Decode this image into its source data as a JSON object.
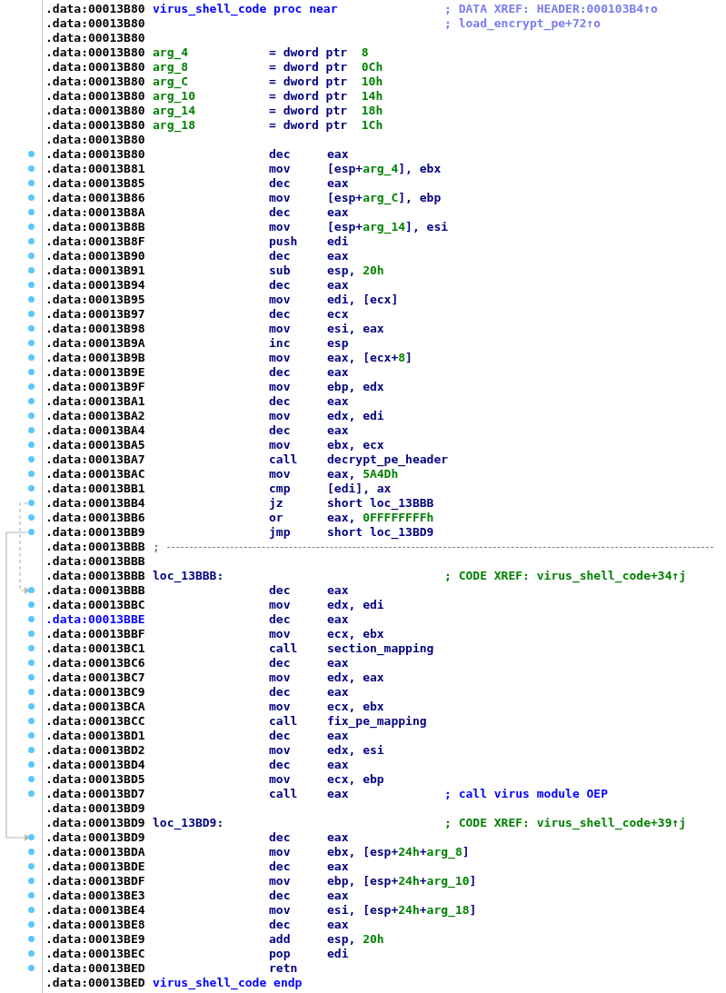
{
  "listing": {
    "rows": [
      {
        "kind": "proc",
        "address": ".data:00013B80",
        "name": "virus_shell_code",
        "directive": "proc near",
        "comment": {
          "kind": "data_xref",
          "text": "; DATA XREF: HEADER:000103B4↑o"
        },
        "selected": false
      },
      {
        "kind": "blank",
        "address": ".data:00013B80",
        "comment": {
          "kind": "data_xref",
          "text": "; load_encrypt_pe+72↑o"
        },
        "selected": false
      },
      {
        "kind": "blank",
        "address": ".data:00013B80",
        "selected": false
      },
      {
        "kind": "arg",
        "address": ".data:00013B80",
        "name": "arg_4",
        "definition": "= dword ptr  8",
        "selected": false
      },
      {
        "kind": "arg",
        "address": ".data:00013B80",
        "name": "arg_8",
        "definition": "= dword ptr  0Ch",
        "selected": false
      },
      {
        "kind": "arg",
        "address": ".data:00013B80",
        "name": "arg_C",
        "definition": "= dword ptr  10h",
        "selected": false
      },
      {
        "kind": "arg",
        "address": ".data:00013B80",
        "name": "arg_10",
        "definition": "= dword ptr  14h",
        "selected": false
      },
      {
        "kind": "arg",
        "address": ".data:00013B80",
        "name": "arg_14",
        "definition": "= dword ptr  18h",
        "selected": false
      },
      {
        "kind": "arg",
        "address": ".data:00013B80",
        "name": "arg_18",
        "definition": "= dword ptr  1Ch",
        "selected": false
      },
      {
        "kind": "blank",
        "address": ".data:00013B80",
        "selected": false
      },
      {
        "kind": "insn",
        "address": ".data:00013B80",
        "mnemonic": "dec",
        "operands": "eax",
        "selected": false
      },
      {
        "kind": "insn",
        "address": ".data:00013B81",
        "mnemonic": "mov",
        "operands": "[esp+arg_4], ebx",
        "selected": false
      },
      {
        "kind": "insn",
        "address": ".data:00013B85",
        "mnemonic": "dec",
        "operands": "eax",
        "selected": false
      },
      {
        "kind": "insn",
        "address": ".data:00013B86",
        "mnemonic": "mov",
        "operands": "[esp+arg_C], ebp",
        "selected": false
      },
      {
        "kind": "insn",
        "address": ".data:00013B8A",
        "mnemonic": "dec",
        "operands": "eax",
        "selected": false
      },
      {
        "kind": "insn",
        "address": ".data:00013B8B",
        "mnemonic": "mov",
        "operands": "[esp+arg_14], esi",
        "selected": false
      },
      {
        "kind": "insn",
        "address": ".data:00013B8F",
        "mnemonic": "push",
        "operands": "edi",
        "selected": false
      },
      {
        "kind": "insn",
        "address": ".data:00013B90",
        "mnemonic": "dec",
        "operands": "eax",
        "selected": false
      },
      {
        "kind": "insn",
        "address": ".data:00013B91",
        "mnemonic": "sub",
        "operands": "esp, 20h",
        "selected": false
      },
      {
        "kind": "insn",
        "address": ".data:00013B94",
        "mnemonic": "dec",
        "operands": "eax",
        "selected": false
      },
      {
        "kind": "insn",
        "address": ".data:00013B95",
        "mnemonic": "mov",
        "operands": "edi, [ecx]",
        "selected": false
      },
      {
        "kind": "insn",
        "address": ".data:00013B97",
        "mnemonic": "dec",
        "operands": "ecx",
        "selected": false
      },
      {
        "kind": "insn",
        "address": ".data:00013B98",
        "mnemonic": "mov",
        "operands": "esi, eax",
        "selected": false
      },
      {
        "kind": "insn",
        "address": ".data:00013B9A",
        "mnemonic": "inc",
        "operands": "esp",
        "selected": false
      },
      {
        "kind": "insn",
        "address": ".data:00013B9B",
        "mnemonic": "mov",
        "operands": "eax, [ecx+8]",
        "selected": false
      },
      {
        "kind": "insn",
        "address": ".data:00013B9E",
        "mnemonic": "dec",
        "operands": "eax",
        "selected": false
      },
      {
        "kind": "insn",
        "address": ".data:00013B9F",
        "mnemonic": "mov",
        "operands": "ebp, edx",
        "selected": false
      },
      {
        "kind": "insn",
        "address": ".data:00013BA1",
        "mnemonic": "dec",
        "operands": "eax",
        "selected": false
      },
      {
        "kind": "insn",
        "address": ".data:00013BA2",
        "mnemonic": "mov",
        "operands": "edx, edi",
        "selected": false
      },
      {
        "kind": "insn",
        "address": ".data:00013BA4",
        "mnemonic": "dec",
        "operands": "eax",
        "selected": false
      },
      {
        "kind": "insn",
        "address": ".data:00013BA5",
        "mnemonic": "mov",
        "operands": "ebx, ecx",
        "selected": false
      },
      {
        "kind": "insn",
        "address": ".data:00013BA7",
        "mnemonic": "call",
        "operands": "decrypt_pe_header",
        "selected": false
      },
      {
        "kind": "insn",
        "address": ".data:00013BAC",
        "mnemonic": "mov",
        "operands": "eax, 5A4Dh",
        "selected": false
      },
      {
        "kind": "insn",
        "address": ".data:00013BB1",
        "mnemonic": "cmp",
        "operands": "[edi], ax",
        "selected": false
      },
      {
        "kind": "insn",
        "address": ".data:00013BB4",
        "mnemonic": "jz",
        "operands": "short loc_13BBB",
        "jump": true,
        "dashed": true,
        "selected": false
      },
      {
        "kind": "insn",
        "address": ".data:00013BB6",
        "mnemonic": "or",
        "operands": "eax, 0FFFFFFFFh",
        "selected": false
      },
      {
        "kind": "insn",
        "address": ".data:00013BB9",
        "mnemonic": "jmp",
        "operands": "short loc_13BD9",
        "jump": true,
        "dashed": false,
        "selected": false
      },
      {
        "kind": "separator",
        "address": ".data:00013BBB",
        "text": ";",
        "selected": false
      },
      {
        "kind": "blank",
        "address": ".data:00013BBB",
        "selected": false
      },
      {
        "kind": "label",
        "address": ".data:00013BBB",
        "name": "loc_13BBB:",
        "comment": {
          "kind": "code_xref",
          "text": "; CODE XREF: virus_shell_code+34↑j"
        },
        "selected": false
      },
      {
        "kind": "insn",
        "address": ".data:00013BBB",
        "mnemonic": "dec",
        "operands": "eax",
        "jump_target": true,
        "selected": false
      },
      {
        "kind": "insn",
        "address": ".data:00013BBC",
        "mnemonic": "mov",
        "operands": "edx, edi",
        "selected": false
      },
      {
        "kind": "insn",
        "address": ".data:00013BBE",
        "mnemonic": "dec",
        "operands": "eax",
        "selected": true
      },
      {
        "kind": "insn",
        "address": ".data:00013BBF",
        "mnemonic": "mov",
        "operands": "ecx, ebx",
        "selected": false
      },
      {
        "kind": "insn",
        "address": ".data:00013BC1",
        "mnemonic": "call",
        "operands": "section_mapping",
        "selected": false
      },
      {
        "kind": "insn",
        "address": ".data:00013BC6",
        "mnemonic": "dec",
        "operands": "eax",
        "selected": false
      },
      {
        "kind": "insn",
        "address": ".data:00013BC7",
        "mnemonic": "mov",
        "operands": "edx, eax",
        "selected": false
      },
      {
        "kind": "insn",
        "address": ".data:00013BC9",
        "mnemonic": "dec",
        "operands": "eax",
        "selected": false
      },
      {
        "kind": "insn",
        "address": ".data:00013BCA",
        "mnemonic": "mov",
        "operands": "ecx, ebx",
        "selected": false
      },
      {
        "kind": "insn",
        "address": ".data:00013BCC",
        "mnemonic": "call",
        "operands": "fix_pe_mapping",
        "selected": false
      },
      {
        "kind": "insn",
        "address": ".data:00013BD1",
        "mnemonic": "dec",
        "operands": "eax",
        "selected": false
      },
      {
        "kind": "insn",
        "address": ".data:00013BD2",
        "mnemonic": "mov",
        "operands": "edx, esi",
        "selected": false
      },
      {
        "kind": "insn",
        "address": ".data:00013BD4",
        "mnemonic": "dec",
        "operands": "eax",
        "selected": false
      },
      {
        "kind": "insn",
        "address": ".data:00013BD5",
        "mnemonic": "mov",
        "operands": "ecx, ebp",
        "selected": false
      },
      {
        "kind": "insn",
        "address": ".data:00013BD7",
        "mnemonic": "call",
        "operands": "eax",
        "comment": {
          "kind": "note",
          "text": "; call virus module OEP"
        },
        "selected": false
      },
      {
        "kind": "blank",
        "address": ".data:00013BD9",
        "selected": false
      },
      {
        "kind": "label",
        "address": ".data:00013BD9",
        "name": "loc_13BD9:",
        "comment": {
          "kind": "code_xref",
          "text": "; CODE XREF: virus_shell_code+39↑j"
        },
        "selected": false
      },
      {
        "kind": "insn",
        "address": ".data:00013BD9",
        "mnemonic": "dec",
        "operands": "eax",
        "jump_target": true,
        "selected": false
      },
      {
        "kind": "insn",
        "address": ".data:00013BDA",
        "mnemonic": "mov",
        "operands": "ebx, [esp+24h+arg_8]",
        "selected": false
      },
      {
        "kind": "insn",
        "address": ".data:00013BDE",
        "mnemonic": "dec",
        "operands": "eax",
        "selected": false
      },
      {
        "kind": "insn",
        "address": ".data:00013BDF",
        "mnemonic": "mov",
        "operands": "ebp, [esp+24h+arg_10]",
        "selected": false
      },
      {
        "kind": "insn",
        "address": ".data:00013BE3",
        "mnemonic": "dec",
        "operands": "eax",
        "selected": false
      },
      {
        "kind": "insn",
        "address": ".data:00013BE4",
        "mnemonic": "mov",
        "operands": "esi, [esp+24h+arg_18]",
        "selected": false
      },
      {
        "kind": "insn",
        "address": ".data:00013BE8",
        "mnemonic": "dec",
        "operands": "eax",
        "selected": false
      },
      {
        "kind": "insn",
        "address": ".data:00013BE9",
        "mnemonic": "add",
        "operands": "esp, 20h",
        "selected": false
      },
      {
        "kind": "insn",
        "address": ".data:00013BEC",
        "mnemonic": "pop",
        "operands": "edi",
        "selected": false
      },
      {
        "kind": "insn",
        "address": ".data:00013BED",
        "mnemonic": "retn",
        "selected": false
      },
      {
        "kind": "endp",
        "address": ".data:00013BED",
        "name": "virus_shell_code",
        "directive": "endp",
        "selected": false
      }
    ]
  }
}
